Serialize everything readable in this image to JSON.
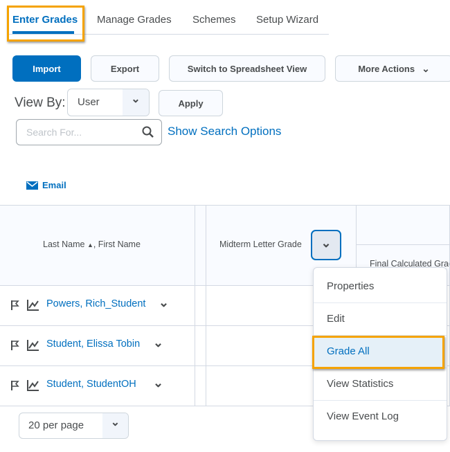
{
  "tabs": [
    "Enter Grades",
    "Manage Grades",
    "Schemes",
    "Setup Wizard"
  ],
  "toolbar": {
    "import": "Import",
    "export": "Export",
    "switch": "Switch to Spreadsheet View",
    "more": "More Actions"
  },
  "view_by": {
    "label": "View By:",
    "value": "User",
    "apply": "Apply"
  },
  "search": {
    "placeholder": "Search For...",
    "options": "Show Search Options"
  },
  "email": "Email",
  "table": {
    "col_name": "Last Name",
    "col_name2": ", First Name",
    "col_midterm": "Midterm Letter Grade",
    "col_final": "Final Calculated Grade",
    "rows": [
      "Powers, Rich_Student",
      "Student, Elissa Tobin",
      "Student, StudentOH"
    ]
  },
  "menu": [
    "Properties",
    "Edit",
    "Grade All",
    "View Statistics",
    "View Event Log"
  ],
  "pagination": "20 per page",
  "colors": {
    "accent": "#006fbf",
    "highlight": "#f5a300"
  }
}
